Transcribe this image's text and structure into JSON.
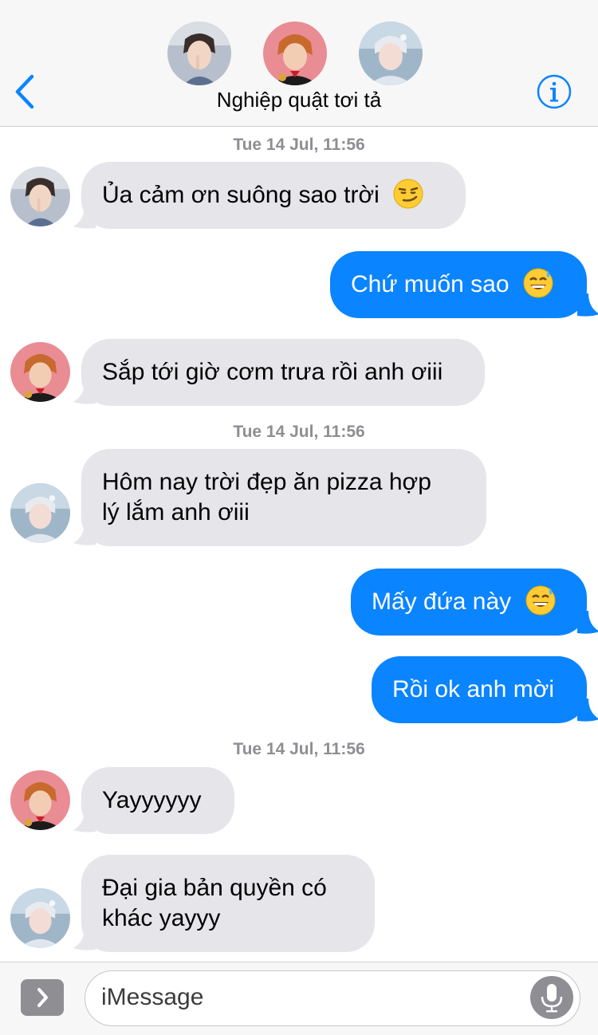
{
  "header": {
    "title": "Nghiệp quật tơi tả"
  },
  "colors": {
    "outgoing_bubble": "#0a84ff",
    "incoming_bubble": "#e5e5ea",
    "accent": "#0a84ff"
  },
  "icons": {
    "back": "chevron-left-icon",
    "info": "info-icon",
    "apps": "chevron-right-icon",
    "mic": "microphone-icon"
  },
  "timestamps": [
    "Tue 14 Jul, 11:56",
    "Tue 14 Jul, 11:56",
    "Tue 14 Jul, 11:56"
  ],
  "messages": [
    {
      "from": "member-1",
      "direction": "incoming",
      "text": "Ủa cảm ơn suông sao trời",
      "emoji": "smirk"
    },
    {
      "from": "me",
      "direction": "outgoing",
      "text": "Chứ muốn sao",
      "emoji": "sweat-smile"
    },
    {
      "from": "member-2",
      "direction": "incoming",
      "text": "Sắp tới giờ cơm trưa rồi anh ơiii"
    },
    {
      "from": "member-3",
      "direction": "incoming",
      "lines": [
        "Hôm nay trời đẹp ăn pizza hợp",
        "lý lắm anh ơiii"
      ]
    },
    {
      "from": "me",
      "direction": "outgoing",
      "text": "Mấy đứa này",
      "emoji": "sweat-smile"
    },
    {
      "from": "me",
      "direction": "outgoing",
      "text": "Rồi ok anh mời"
    },
    {
      "from": "member-2",
      "direction": "incoming",
      "text": "Yayyyyyy"
    },
    {
      "from": "member-3",
      "direction": "incoming",
      "lines": [
        "Đại gia bản quyền có",
        "khác yayyy"
      ]
    }
  ],
  "composer": {
    "placeholder": "iMessage"
  }
}
